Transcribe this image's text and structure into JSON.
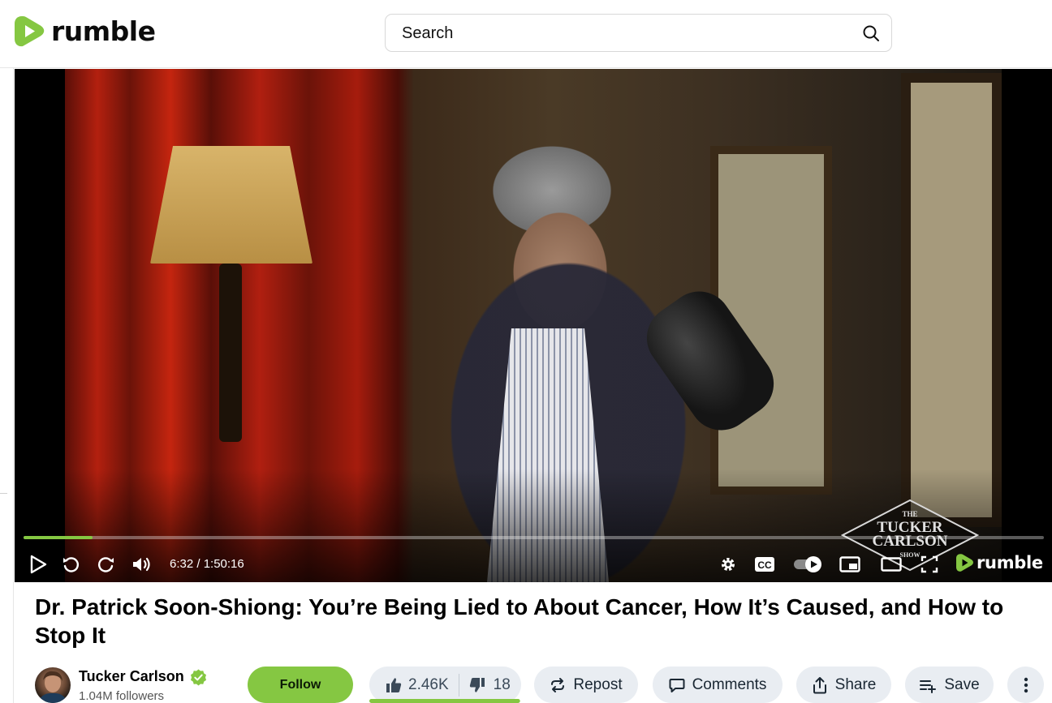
{
  "header": {
    "logo_text": "rumble",
    "search_placeholder": "Search"
  },
  "player": {
    "time_display": "6:32 / 1:50:16",
    "progress_fraction": 0.068,
    "logo_text": "rumble",
    "watermark_lines": [
      "THE",
      "TUCKER",
      "CARLSON",
      "SHOW"
    ]
  },
  "video": {
    "title": "Dr. Patrick Soon-Shiong: You’re Being Lied to About Cancer, How It’s Caused, and How to Stop It"
  },
  "channel": {
    "name": "Tucker Carlson",
    "followers": "1.04M followers",
    "verified": true
  },
  "actions": {
    "follow_label": "Follow",
    "likes": "2.46K",
    "dislikes": "18",
    "like_fraction": 0.993,
    "repost_label": "Repost",
    "comments_label": "Comments",
    "share_label": "Share",
    "save_label": "Save"
  },
  "colors": {
    "brand_green": "#85c742",
    "button_bg": "#e9edf2"
  },
  "icons": [
    "rumble-logo-icon",
    "search-icon",
    "play-icon",
    "rewind-icon",
    "forward-icon",
    "volume-icon",
    "settings-icon",
    "captions-icon",
    "autoplay-toggle-icon",
    "pip-icon",
    "theater-icon",
    "fullscreen-icon",
    "verified-icon",
    "thumbs-up-icon",
    "thumbs-down-icon",
    "repost-icon",
    "comment-icon",
    "share-icon",
    "save-playlist-icon",
    "more-vertical-icon"
  ]
}
